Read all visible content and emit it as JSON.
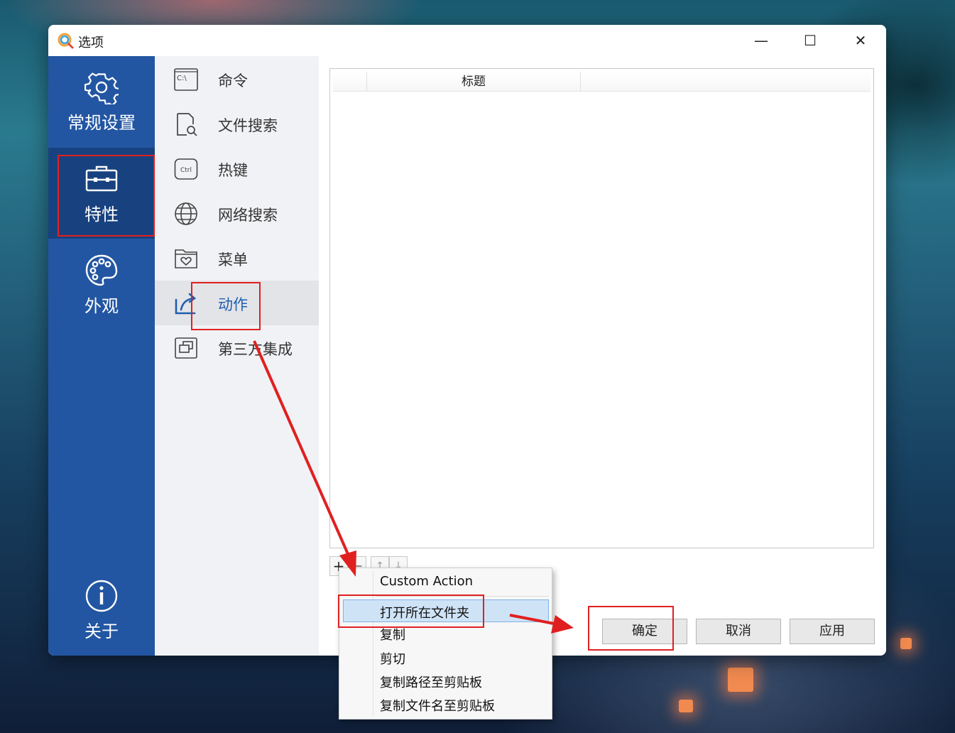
{
  "window": {
    "title": "选项",
    "controls": {
      "minimize": "—",
      "maximize": "☐",
      "close": "✕"
    }
  },
  "sidebar": {
    "items": [
      {
        "label": "常规设置",
        "icon": "gear-icon",
        "active": false
      },
      {
        "label": "特性",
        "icon": "toolbox-icon",
        "active": true
      },
      {
        "label": "外观",
        "icon": "palette-icon",
        "active": false
      },
      {
        "label": "关于",
        "icon": "info-icon",
        "active": false
      }
    ]
  },
  "subnav": {
    "items": [
      {
        "label": "命令",
        "icon": "command-prompt-icon",
        "icon_text": "C:\\"
      },
      {
        "label": "文件搜索",
        "icon": "file-search-icon"
      },
      {
        "label": "热键",
        "icon": "ctrl-key-icon",
        "icon_text": "Ctrl"
      },
      {
        "label": "网络搜索",
        "icon": "globe-icon"
      },
      {
        "label": "菜单",
        "icon": "menu-folder-heart-icon"
      },
      {
        "label": "动作",
        "icon": "action-arrow-icon",
        "active": true
      },
      {
        "label": "第三方集成",
        "icon": "integration-windows-icon"
      }
    ]
  },
  "actions_list": {
    "columns": [
      "标题"
    ]
  },
  "list_toolbar": {
    "add": "+",
    "remove": "—",
    "up": "↑",
    "down": "↓"
  },
  "context_menu": {
    "items": [
      {
        "label": "Custom Action"
      },
      {
        "label": "打开所在文件夹",
        "highlighted": true
      },
      {
        "label": "复制"
      },
      {
        "label": "剪切"
      },
      {
        "label": "复制路径至剪贴板"
      },
      {
        "label": "复制文件名至剪贴板"
      }
    ]
  },
  "footer": {
    "ok": "确定",
    "cancel": "取消",
    "apply": "应用"
  },
  "colors": {
    "sidebar": "#2356a2",
    "sidebar_active": "#18427f",
    "accent": "#1f5fae",
    "annotation": "#e02020",
    "menu_highlight": "#cfe3f7"
  }
}
